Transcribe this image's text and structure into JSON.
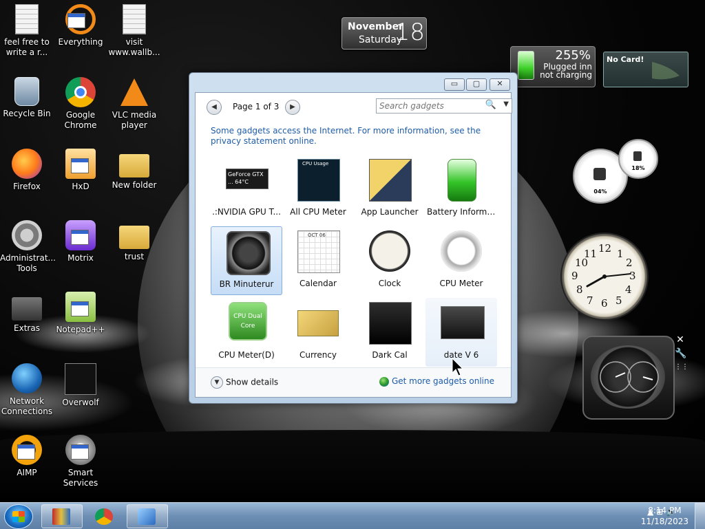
{
  "desktop": {
    "icons": [
      {
        "label": "feel free to write a r...",
        "icon": "text-document-icon"
      },
      {
        "label": "Everything",
        "icon": "everything-search-icon"
      },
      {
        "label": "visit www.wallb...",
        "icon": "text-document-icon"
      },
      {
        "label": "Recycle Bin",
        "icon": "recycle-bin-icon"
      },
      {
        "label": "Google Chrome",
        "icon": "chrome-icon"
      },
      {
        "label": "VLC media player",
        "icon": "vlc-cone-icon"
      },
      {
        "label": "Firefox",
        "icon": "firefox-icon"
      },
      {
        "label": "HxD",
        "icon": "hex-editor-icon"
      },
      {
        "label": "New folder",
        "icon": "folder-icon"
      },
      {
        "label": "Administrat... Tools",
        "icon": "admin-tools-icon"
      },
      {
        "label": "Motrix",
        "icon": "motrix-icon"
      },
      {
        "label": "trust",
        "icon": "folder-icon"
      },
      {
        "label": "Extras",
        "icon": "folder-icon"
      },
      {
        "label": "Notepad++",
        "icon": "notepadpp-icon"
      },
      {
        "label": "Network Connections",
        "icon": "network-globe-icon"
      },
      {
        "label": "Overwolf",
        "icon": "overwolf-icon"
      },
      {
        "label": "AIMP",
        "icon": "aimp-icon"
      },
      {
        "label": "Smart Services",
        "icon": "services-icon"
      }
    ]
  },
  "date_gadget": {
    "month": "November",
    "weekday": "Saturday",
    "day": "18"
  },
  "battery_gadget": {
    "percent": "255%",
    "status_line1": "Plugged inn",
    "status_line2": "not charging"
  },
  "nvidia_gadget": {
    "label": "No Card!"
  },
  "cpu_gadget": {
    "gauge1": "04%",
    "gauge2": "18%"
  },
  "clock_gadget": {
    "numbers": [
      "12",
      "1",
      "2",
      "3",
      "4",
      "5",
      "6",
      "7",
      "8",
      "9",
      "10",
      "11"
    ]
  },
  "side_controls": {
    "close": "✕",
    "settings": "🔧",
    "drag": "⋮⋮"
  },
  "gallery": {
    "window_buttons": {
      "minimize": "▭",
      "restore": "▢",
      "close": "✕"
    },
    "pager": {
      "prev": "◀",
      "next": "▶",
      "label": "Page 1 of 3"
    },
    "search": {
      "placeholder": "Search gadgets",
      "icon": "🔍",
      "dropdown": "▼"
    },
    "notice": "Some gadgets access the Internet.  For more information, see the privacy statement online.",
    "tiles": [
      {
        "label": ".:NVIDIA GPU T...",
        "thumb": "nvidia-gpu",
        "thumb_text": "GeForce GTX ... 64°C",
        "state": "normal"
      },
      {
        "label": "All CPU Meter",
        "thumb": "all-cpu-meter",
        "thumb_text": "CPU Usage",
        "state": "normal"
      },
      {
        "label": "App Launcher",
        "thumb": "app-launcher",
        "thumb_text": "",
        "state": "normal"
      },
      {
        "label": "Battery Informa...",
        "thumb": "battery",
        "thumb_text": "",
        "state": "normal"
      },
      {
        "label": "BR Minuterur",
        "thumb": "br-minuterur",
        "thumb_text": "",
        "state": "selected"
      },
      {
        "label": "Calendar",
        "thumb": "calendar",
        "thumb_text": "OCT 06",
        "state": "normal"
      },
      {
        "label": "Clock",
        "thumb": "clock",
        "thumb_text": "",
        "state": "normal"
      },
      {
        "label": "CPU Meter",
        "thumb": "cpu-meter",
        "thumb_text": "",
        "state": "normal"
      },
      {
        "label": "CPU Meter(D)",
        "thumb": "cpu-meter-d",
        "thumb_text": "CPU Dual Core",
        "state": "normal"
      },
      {
        "label": "Currency",
        "thumb": "currency",
        "thumb_text": "",
        "state": "normal"
      },
      {
        "label": "Dark Cal",
        "thumb": "dark-cal",
        "thumb_text": "",
        "state": "normal"
      },
      {
        "label": "date V 6",
        "thumb": "date-v6",
        "thumb_text": "",
        "state": "hover"
      }
    ],
    "footer": {
      "show_details": "Show details",
      "details_icon": "▼",
      "more_online": "Get more gadgets online"
    }
  },
  "taskbar": {
    "pinned": [
      "winrar-icon",
      "chrome-icon",
      "gadget-tool-icon"
    ],
    "tray_icons": "▲  ⊞  🔊",
    "time": "8:14 PM",
    "date": "11/18/2023"
  },
  "colors": {
    "link": "#1e5ca8",
    "taskbar": "#6e8fb4",
    "selected_tile": "#c6ddf6"
  }
}
